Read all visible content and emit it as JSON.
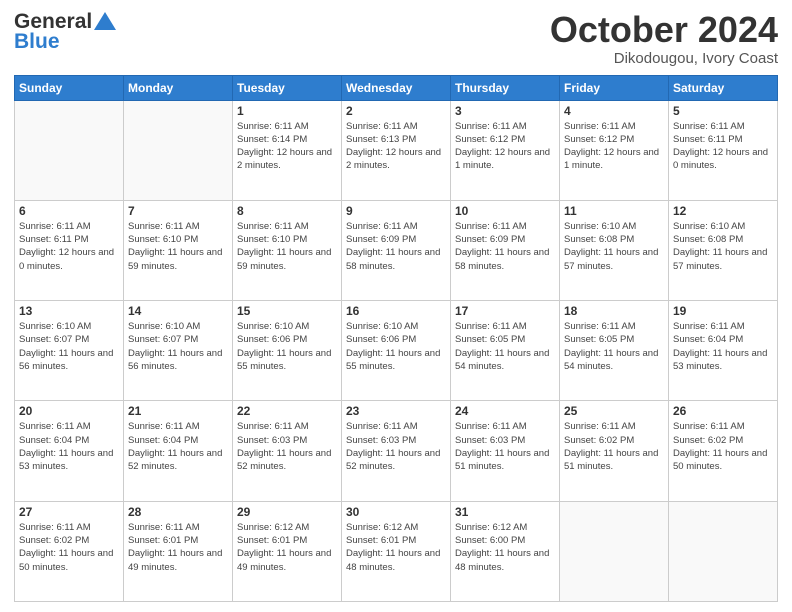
{
  "header": {
    "logo_line1": "General",
    "logo_line2": "Blue",
    "title": "October 2024",
    "subtitle": "Dikodougou, Ivory Coast"
  },
  "days_of_week": [
    "Sunday",
    "Monday",
    "Tuesday",
    "Wednesday",
    "Thursday",
    "Friday",
    "Saturday"
  ],
  "weeks": [
    [
      {
        "day": "",
        "info": ""
      },
      {
        "day": "",
        "info": ""
      },
      {
        "day": "1",
        "info": "Sunrise: 6:11 AM\nSunset: 6:14 PM\nDaylight: 12 hours and 2 minutes."
      },
      {
        "day": "2",
        "info": "Sunrise: 6:11 AM\nSunset: 6:13 PM\nDaylight: 12 hours and 2 minutes."
      },
      {
        "day": "3",
        "info": "Sunrise: 6:11 AM\nSunset: 6:12 PM\nDaylight: 12 hours and 1 minute."
      },
      {
        "day": "4",
        "info": "Sunrise: 6:11 AM\nSunset: 6:12 PM\nDaylight: 12 hours and 1 minute."
      },
      {
        "day": "5",
        "info": "Sunrise: 6:11 AM\nSunset: 6:11 PM\nDaylight: 12 hours and 0 minutes."
      }
    ],
    [
      {
        "day": "6",
        "info": "Sunrise: 6:11 AM\nSunset: 6:11 PM\nDaylight: 12 hours and 0 minutes."
      },
      {
        "day": "7",
        "info": "Sunrise: 6:11 AM\nSunset: 6:10 PM\nDaylight: 11 hours and 59 minutes."
      },
      {
        "day": "8",
        "info": "Sunrise: 6:11 AM\nSunset: 6:10 PM\nDaylight: 11 hours and 59 minutes."
      },
      {
        "day": "9",
        "info": "Sunrise: 6:11 AM\nSunset: 6:09 PM\nDaylight: 11 hours and 58 minutes."
      },
      {
        "day": "10",
        "info": "Sunrise: 6:11 AM\nSunset: 6:09 PM\nDaylight: 11 hours and 58 minutes."
      },
      {
        "day": "11",
        "info": "Sunrise: 6:10 AM\nSunset: 6:08 PM\nDaylight: 11 hours and 57 minutes."
      },
      {
        "day": "12",
        "info": "Sunrise: 6:10 AM\nSunset: 6:08 PM\nDaylight: 11 hours and 57 minutes."
      }
    ],
    [
      {
        "day": "13",
        "info": "Sunrise: 6:10 AM\nSunset: 6:07 PM\nDaylight: 11 hours and 56 minutes."
      },
      {
        "day": "14",
        "info": "Sunrise: 6:10 AM\nSunset: 6:07 PM\nDaylight: 11 hours and 56 minutes."
      },
      {
        "day": "15",
        "info": "Sunrise: 6:10 AM\nSunset: 6:06 PM\nDaylight: 11 hours and 55 minutes."
      },
      {
        "day": "16",
        "info": "Sunrise: 6:10 AM\nSunset: 6:06 PM\nDaylight: 11 hours and 55 minutes."
      },
      {
        "day": "17",
        "info": "Sunrise: 6:11 AM\nSunset: 6:05 PM\nDaylight: 11 hours and 54 minutes."
      },
      {
        "day": "18",
        "info": "Sunrise: 6:11 AM\nSunset: 6:05 PM\nDaylight: 11 hours and 54 minutes."
      },
      {
        "day": "19",
        "info": "Sunrise: 6:11 AM\nSunset: 6:04 PM\nDaylight: 11 hours and 53 minutes."
      }
    ],
    [
      {
        "day": "20",
        "info": "Sunrise: 6:11 AM\nSunset: 6:04 PM\nDaylight: 11 hours and 53 minutes."
      },
      {
        "day": "21",
        "info": "Sunrise: 6:11 AM\nSunset: 6:04 PM\nDaylight: 11 hours and 52 minutes."
      },
      {
        "day": "22",
        "info": "Sunrise: 6:11 AM\nSunset: 6:03 PM\nDaylight: 11 hours and 52 minutes."
      },
      {
        "day": "23",
        "info": "Sunrise: 6:11 AM\nSunset: 6:03 PM\nDaylight: 11 hours and 52 minutes."
      },
      {
        "day": "24",
        "info": "Sunrise: 6:11 AM\nSunset: 6:03 PM\nDaylight: 11 hours and 51 minutes."
      },
      {
        "day": "25",
        "info": "Sunrise: 6:11 AM\nSunset: 6:02 PM\nDaylight: 11 hours and 51 minutes."
      },
      {
        "day": "26",
        "info": "Sunrise: 6:11 AM\nSunset: 6:02 PM\nDaylight: 11 hours and 50 minutes."
      }
    ],
    [
      {
        "day": "27",
        "info": "Sunrise: 6:11 AM\nSunset: 6:02 PM\nDaylight: 11 hours and 50 minutes."
      },
      {
        "day": "28",
        "info": "Sunrise: 6:11 AM\nSunset: 6:01 PM\nDaylight: 11 hours and 49 minutes."
      },
      {
        "day": "29",
        "info": "Sunrise: 6:12 AM\nSunset: 6:01 PM\nDaylight: 11 hours and 49 minutes."
      },
      {
        "day": "30",
        "info": "Sunrise: 6:12 AM\nSunset: 6:01 PM\nDaylight: 11 hours and 48 minutes."
      },
      {
        "day": "31",
        "info": "Sunrise: 6:12 AM\nSunset: 6:00 PM\nDaylight: 11 hours and 48 minutes."
      },
      {
        "day": "",
        "info": ""
      },
      {
        "day": "",
        "info": ""
      }
    ]
  ]
}
